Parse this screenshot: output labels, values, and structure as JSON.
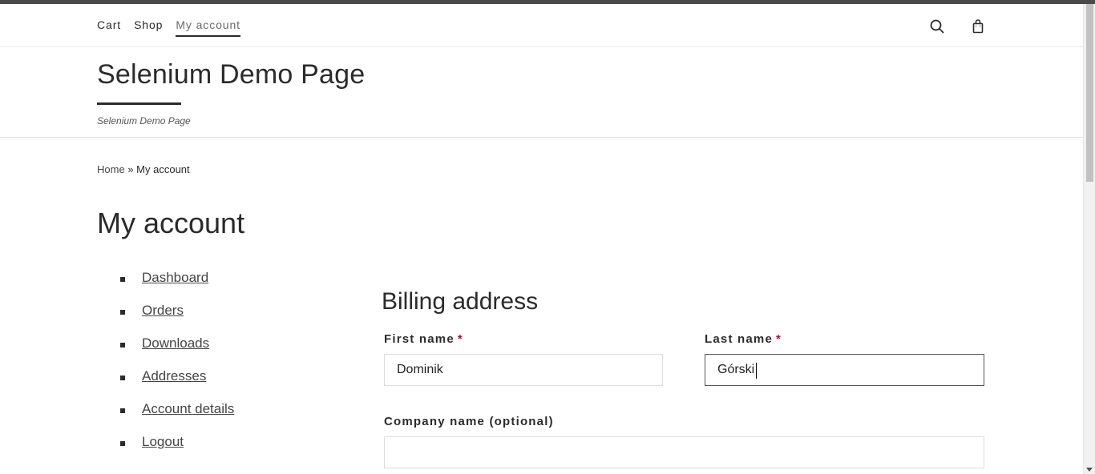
{
  "nav": {
    "links": [
      {
        "label": "Cart"
      },
      {
        "label": "Shop"
      },
      {
        "label": "My account"
      }
    ],
    "icons": [
      "search-icon",
      "shopping-bag-icon"
    ]
  },
  "header": {
    "site_title": "Selenium Demo Page",
    "tagline": "Selenium Demo Page"
  },
  "breadcrumb": {
    "home": "Home",
    "separator": "»",
    "current": "My account"
  },
  "page_title": "My account",
  "account_nav": [
    {
      "label": "Dashboard"
    },
    {
      "label": "Orders"
    },
    {
      "label": "Downloads"
    },
    {
      "label": "Addresses"
    },
    {
      "label": "Account details"
    },
    {
      "label": "Logout"
    }
  ],
  "billing": {
    "title": "Billing address",
    "required_mark": "*",
    "first_name": {
      "label": "First name",
      "value": "Dominik"
    },
    "last_name": {
      "label": "Last name",
      "value": "Górski"
    },
    "company": {
      "label": "Company name (optional)",
      "value": ""
    }
  },
  "colors": {
    "required": "#d0021b",
    "text": "#2b2b2b",
    "top_bar": "#4a4a4a"
  }
}
